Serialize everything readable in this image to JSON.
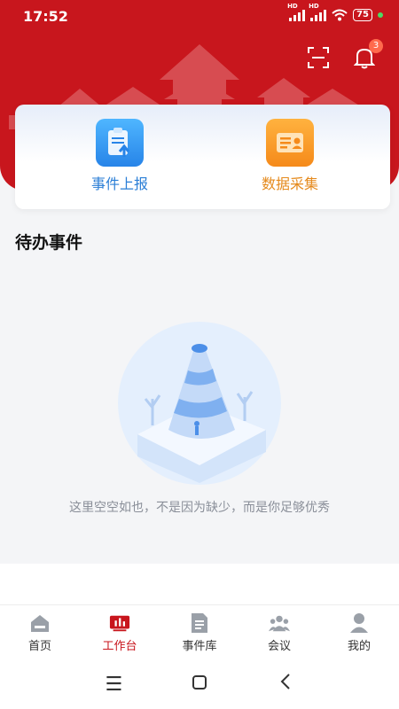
{
  "status_bar": {
    "time": "17:52",
    "battery": "75",
    "network_1": "HD",
    "network_2": "HD"
  },
  "header": {
    "scan_icon": "scan-icon",
    "bell_icon": "bell-icon",
    "notification_count": "3",
    "brand_color": "#c8161d"
  },
  "quick_actions": [
    {
      "label": "事件上报",
      "icon": "clipboard-upload-icon",
      "color": "#2a7ed6"
    },
    {
      "label": "数据采集",
      "icon": "id-card-icon",
      "color": "#e58a1d"
    }
  ],
  "pending": {
    "title": "待办事件",
    "empty_message": "这里空空如也，不是因为缺少，而是你足够优秀"
  },
  "tabbar": {
    "items": [
      {
        "label": "首页",
        "icon": "home-icon",
        "active": false
      },
      {
        "label": "工作台",
        "icon": "workbench-icon",
        "active": true
      },
      {
        "label": "事件库",
        "icon": "document-list-icon",
        "active": false
      },
      {
        "label": "会议",
        "icon": "people-icon",
        "active": false
      },
      {
        "label": "我的",
        "icon": "user-icon",
        "active": false
      }
    ]
  },
  "system_nav": {
    "menu_icon": "menu-icon",
    "home_icon": "square-home-icon",
    "back_icon": "back-icon"
  }
}
